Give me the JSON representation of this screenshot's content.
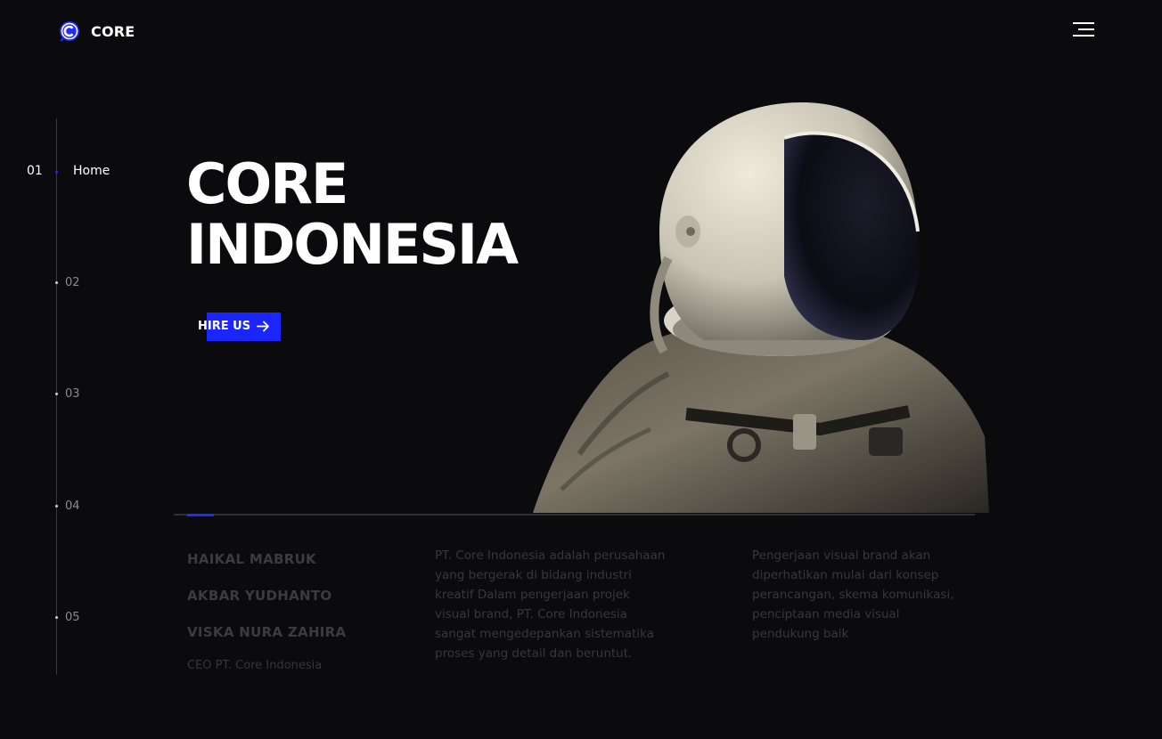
{
  "header": {
    "logo_text": "CORE",
    "logo_icon": "c-logo-icon",
    "menu_icon": "hamburger-menu-icon"
  },
  "side_nav": {
    "items": [
      {
        "number": "01",
        "label": "Home",
        "active": true
      },
      {
        "number": "02"
      },
      {
        "number": "03"
      },
      {
        "number": "04"
      },
      {
        "number": "05"
      }
    ]
  },
  "hero": {
    "title_line1": "CORE",
    "title_line2": "INDONESIA",
    "cta_label": "HIRE US",
    "cta_icon": "arrow-right-icon",
    "image": "astronaut-image"
  },
  "info": {
    "team": [
      "HAIKAL MABRUK",
      "AKBAR YUDHANTO",
      "VISKA NURA ZAHIRA"
    ],
    "role": "CEO PT. Core Indonesia",
    "description_1": "PT. Core Indonesia adalah perusahaan yang bergerak di bidang industri kreatif Dalam pengerjaan projek visual brand, PT. Core Indonesia sangat mengedepankan sistematika proses yang detail dan beruntut.",
    "description_2": "Pengerjaan visual brand akan diperhatikan mulai dari konsep perancangan, skema komunikasi, penciptaan media visual pendukung baik"
  },
  "colors": {
    "background": "#0b0b0d",
    "accent": "#1b26ff",
    "text": "#ffffff",
    "muted_text": "#38383c"
  }
}
